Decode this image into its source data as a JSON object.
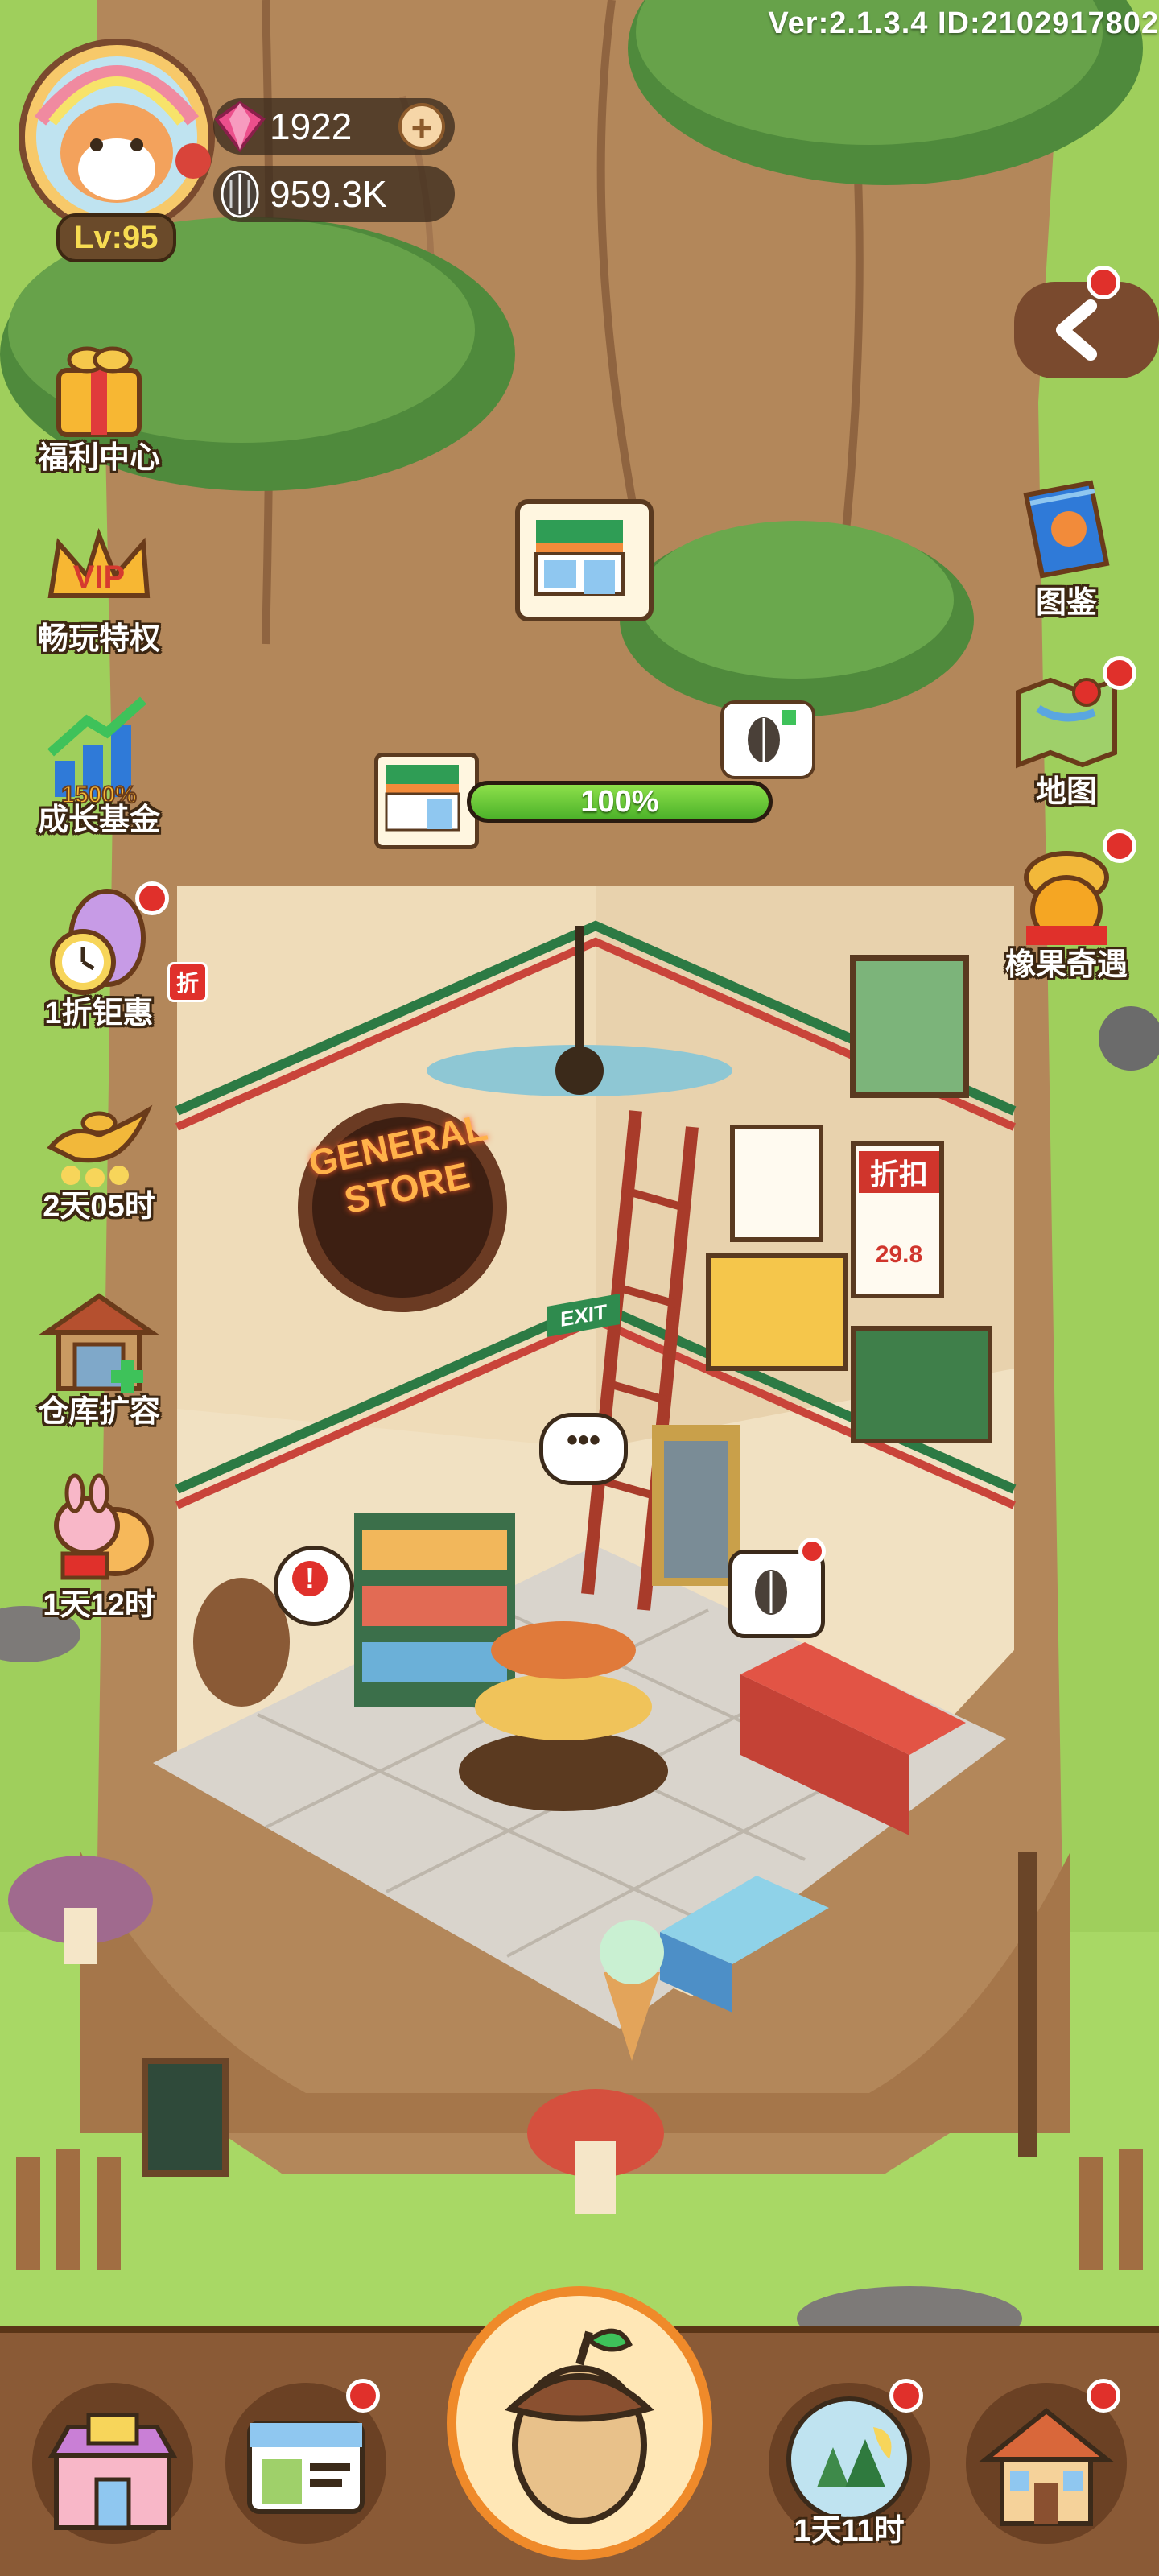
{
  "header": {
    "version": "Ver:2.1.3.4 ID:2102917802"
  },
  "player": {
    "level": "Lv:95",
    "gems": "1922",
    "seeds": "959.3K"
  },
  "left_menu": [
    {
      "label": "福利中心",
      "icon": "gift-box-icon",
      "badge": false
    },
    {
      "label": "畅玩特权",
      "icon": "vip-crown-icon",
      "badge": false
    },
    {
      "label": "成长基金",
      "icon": "growth-chart-icon",
      "badge": false
    },
    {
      "label": "1折钜惠",
      "icon": "easter-egg-clock-icon",
      "badge": true,
      "tag": "折"
    },
    {
      "label": "2天05时",
      "icon": "magic-lamp-icon",
      "badge": false
    },
    {
      "label": "仓库扩容",
      "icon": "warehouse-icon",
      "badge": false
    },
    {
      "label": "1天12时",
      "icon": "rabbit-mooncake-icon",
      "badge": false
    }
  ],
  "right_menu": [
    {
      "label": "图鉴",
      "icon": "book-icon",
      "badge": false
    },
    {
      "label": "地图",
      "icon": "map-pin-icon",
      "badge": true
    },
    {
      "label": "橡果奇遇",
      "icon": "acorn-adventure-icon",
      "badge": true
    }
  ],
  "store": {
    "sign_line1": "GENERAL",
    "sign_line2": "STORE",
    "exit_sign": "EXIT",
    "price_sign_title": "折扣",
    "price_sign_value": "29.8",
    "progress_percent": 100,
    "progress_text": "100%"
  },
  "bottom_nav": [
    {
      "label": "",
      "icon": "shop-cart-icon",
      "badge": false
    },
    {
      "label": "",
      "icon": "id-card-icon",
      "badge": true
    },
    {
      "label": "",
      "icon": "big-acorn-icon",
      "badge": false
    },
    {
      "label": "1天11时",
      "icon": "forest-globe-icon",
      "badge": true
    },
    {
      "label": "",
      "icon": "house-icon",
      "badge": true
    }
  ],
  "colors": {
    "grass": "#9fcf5c",
    "trunk": "#b3875a",
    "progress_green": "#5cc434",
    "red_badge": "#e0302b"
  }
}
